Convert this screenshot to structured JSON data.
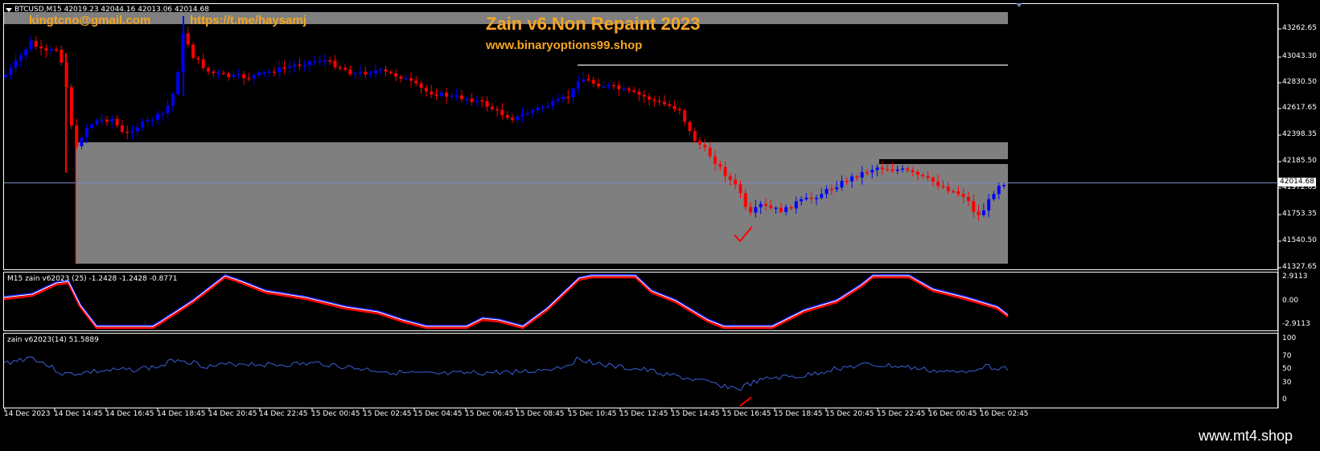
{
  "main_panel": {
    "header": "BTCUSD,M15  42019.23 42044.16 42013.06 42014.68",
    "email": "kingtcno@gmail.com",
    "telegram": "https://t.me/haysamj",
    "title": "Zain v6.Non Repaint 2023",
    "website": "www.binaryoptions99.shop",
    "current_price": "42014.68",
    "price_axis": [
      "43262.65",
      "43043.30",
      "42830.50",
      "42617.65",
      "42398.35",
      "42185.50",
      "41972.65",
      "41753.35",
      "41540.50",
      "41327.65"
    ]
  },
  "indicator1": {
    "header": "M15 zain v62023 (25) -1.2428 -1.2428 -0.8771",
    "axis": [
      "2.9113",
      "0.00",
      "-2.9113"
    ]
  },
  "indicator2": {
    "header": "zain v62023(14) 51.5889",
    "axis": [
      "100",
      "70",
      "50",
      "30",
      "0"
    ]
  },
  "time_axis": [
    "14 Dec 2023",
    "14 Dec 14:45",
    "14 Dec 16:45",
    "14 Dec 18:45",
    "14 Dec 20:45",
    "14 Dec 22:45",
    "15 Dec 00:45",
    "15 Dec 02:45",
    "15 Dec 04:45",
    "15 Dec 06:45",
    "15 Dec 08:45",
    "15 Dec 10:45",
    "15 Dec 12:45",
    "15 Dec 14:45",
    "15 Dec 16:45",
    "15 Dec 18:45",
    "15 Dec 20:45",
    "15 Dec 22:45",
    "16 Dec 00:45",
    "16 Dec 02:45"
  ],
  "footer": "www.mt4.shop",
  "colors": {
    "bull": "#0000ff",
    "bear": "#ff0000",
    "zone": "#7f7f7f",
    "accent": "#f5a623",
    "grid": "#ffffff"
  }
}
